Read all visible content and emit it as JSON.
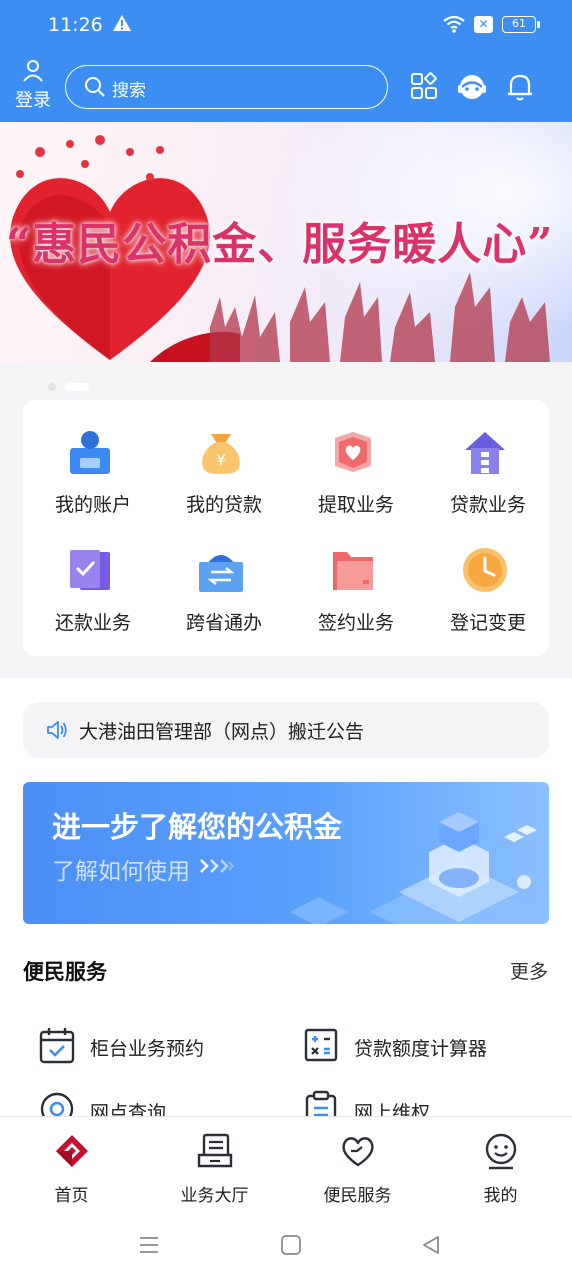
{
  "status_bar": {
    "time": "11:26",
    "battery": "61"
  },
  "header": {
    "login_label": "登录",
    "search_placeholder": "搜索"
  },
  "banner": {
    "slogan": "“惠民公积金、服务暖人心”"
  },
  "grid": [
    {
      "label": "我的账户",
      "icon": "account-icon"
    },
    {
      "label": "我的贷款",
      "icon": "money-bag-icon"
    },
    {
      "label": "提取业务",
      "icon": "withdraw-heart-icon"
    },
    {
      "label": "贷款业务",
      "icon": "house-icon"
    },
    {
      "label": "还款业务",
      "icon": "repay-check-icon"
    },
    {
      "label": "跨省通办",
      "icon": "transfer-arrows-icon"
    },
    {
      "label": "签约业务",
      "icon": "folder-icon"
    },
    {
      "label": "登记变更",
      "icon": "clock-icon"
    }
  ],
  "notice": {
    "text": "大港油田管理部（网点）搬迁公告"
  },
  "promo": {
    "title": "进一步了解您的公积金",
    "subtitle": "了解如何使用"
  },
  "services": {
    "title": "便民服务",
    "more": "更多",
    "items": [
      {
        "label": "柜台业务预约",
        "icon": "calendar-check-icon"
      },
      {
        "label": "贷款额度计算器",
        "icon": "calculator-icon"
      },
      {
        "label": "网点查询",
        "icon": "location-icon"
      },
      {
        "label": "网上维权",
        "icon": "clipboard-icon"
      }
    ]
  },
  "tabs": [
    {
      "label": "首页",
      "icon": "home-logo-icon"
    },
    {
      "label": "业务大厅",
      "icon": "business-hall-icon"
    },
    {
      "label": "便民服务",
      "icon": "heart-hand-icon"
    },
    {
      "label": "我的",
      "icon": "profile-face-icon"
    }
  ],
  "colors": {
    "header": "#3d8ef2",
    "accent": "#4c8ff6",
    "home_red": "#c8102e"
  }
}
